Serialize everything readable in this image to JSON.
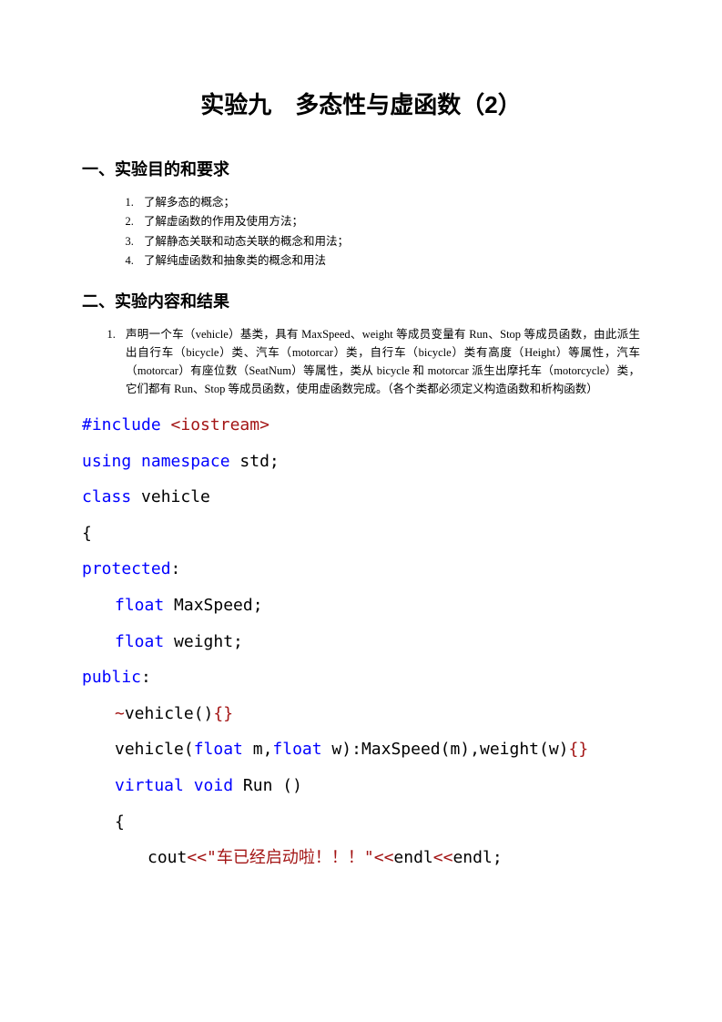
{
  "title": "实验九　多态性与虚函数（2）",
  "section1": "一、实验目的和要求",
  "objectives": [
    "了解多态的概念；",
    "了解虚函数的作用及使用方法；",
    "了解静态关联和动态关联的概念和用法；",
    "了解纯虚函数和抽象类的概念和用法"
  ],
  "section2": "二、实验内容和结果",
  "task": "声明一个车（vehicle）基类，具有 MaxSpeed、weight 等成员变量有 Run、Stop 等成员函数，由此派生出自行车（bicycle）类、汽车（motorcar）类，自行车（bicycle）类有高度（Height）等属性，汽车（motorcar）有座位数（SeatNum）等属性，类从 bicycle 和 motorcar 派生出摩托车（motorcycle）类，它们都有 Run、Stop 等成员函数，使用虚函数完成。（各个类都必须定义构造函数和析构函数）",
  "code": {
    "l1a": "#include ",
    "l1b": "<iostream>",
    "l2a": "using",
    "l2b": " ",
    "l2c": "namespace",
    "l2d": " std;",
    "l3a": "class",
    "l3b": " vehicle",
    "l4": "{",
    "l5a": "protected",
    "l5b": ":",
    "l6a": "float",
    "l6b": " MaxSpeed;",
    "l7a": "float",
    "l7b": " weight;",
    "l8a": "public",
    "l8b": ":",
    "l9a": "~",
    "l9b": "vehicle()",
    "l9c": "{}",
    "l10a": "vehicle(",
    "l10b": "float",
    "l10c": " m,",
    "l10d": "float",
    "l10e": " w):MaxSpeed(m),weight(w)",
    "l10f": "{}",
    "l11a": "virtual",
    "l11b": " ",
    "l11c": "void",
    "l11d": " Run ()",
    "l12": "{",
    "l13a": "cout",
    "l13b": "<<",
    "l13c": "\"车已经启动啦！！！\"",
    "l13d": "<<",
    "l13e": "endl",
    "l13f": "<<",
    "l13g": "endl;"
  }
}
